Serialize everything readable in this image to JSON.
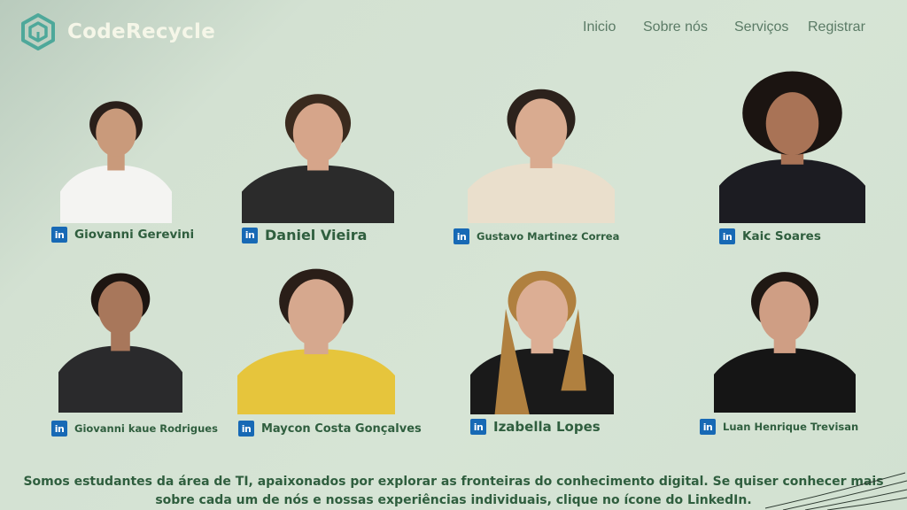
{
  "brand": {
    "name": "CodeRecycle",
    "logo_icon": "recycle-cube-icon",
    "text_color": "#f5f6e8",
    "accent_color": "#4ea89a"
  },
  "nav": {
    "items": [
      {
        "label": "Inicio"
      },
      {
        "label": "Sobre nós"
      },
      {
        "label": "Serviços"
      },
      {
        "label": "Registrar"
      }
    ]
  },
  "team": [
    {
      "name": "Giovanni Gerevini",
      "shirt": "#f4f4f2",
      "skin": "#c99a7b",
      "hair": "#2a1f1a"
    },
    {
      "name": "Daniel Vieira",
      "shirt": "#2b2b2b",
      "skin": "#d6a58a",
      "hair": "#3a2a1e"
    },
    {
      "name": "Gustavo Martinez Correa",
      "shirt": "#eadfcc",
      "skin": "#d9ab90",
      "hair": "#2c221c"
    },
    {
      "name": "Kaic Soares",
      "shirt": "#1c1c22",
      "skin": "#a97356",
      "hair": "#1b1411"
    },
    {
      "name": "Giovanni kaue Rodrigues",
      "shirt": "#2a2a2c",
      "skin": "#a8775b",
      "hair": "#1d1511"
    },
    {
      "name": "Maycon Costa Gonçalves",
      "shirt": "#e6c53c",
      "skin": "#d6a88e",
      "hair": "#2a1e18"
    },
    {
      "name": "Izabella Lopes",
      "shirt": "#1a1a1a",
      "skin": "#dcae94",
      "hair": "#b0803f"
    },
    {
      "name": "Luan Henrique Trevisan",
      "shirt": "#151515",
      "skin": "#cf9e84",
      "hair": "#1f1813"
    }
  ],
  "linkedin": {
    "icon": "linkedin-icon",
    "label": "in",
    "color": "#1769b5"
  },
  "about": {
    "text": "Somos estudantes da área de TI, apaixonados por explorar as fronteiras do conhecimento digital. Se quiser conhecer mais sobre cada um de nós e nossas experiências individuais, clique no ícone do LinkedIn."
  }
}
